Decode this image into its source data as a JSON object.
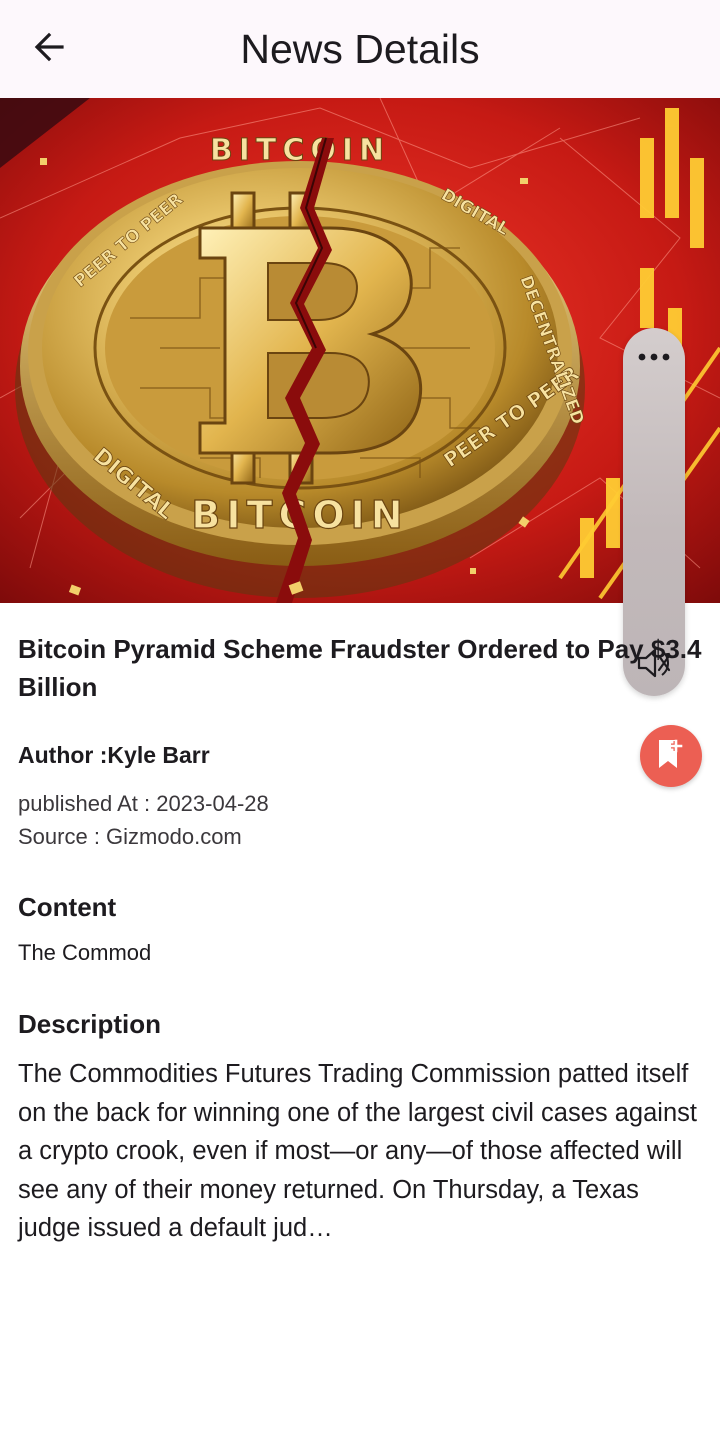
{
  "appbar": {
    "title": "News Details",
    "back_icon": "arrow-left-icon"
  },
  "hero": {
    "image": "bitcoin-coin-cracked-photo",
    "coin_top_text": "BITCOIN",
    "coin_bottom_text": "BITCOIN",
    "coin_ring_left": "DIGITAL",
    "coin_ring_right": "PEER TO PEER",
    "coin_ring_upper_right": "DECENTRALIZED",
    "coin_ring_upper": "DIGITAL",
    "coin_ring_upper_left": "PEER TO PEER"
  },
  "floating_panel": {
    "more_icon": "more-horizontal-icon",
    "mute_icon": "volume-mute-icon"
  },
  "bookmark": {
    "icon": "bookmark-add-icon",
    "color": "#ec5f53"
  },
  "article": {
    "title": "Bitcoin Pyramid Scheme Fraudster Ordered to Pay $3.4 Billion",
    "author": "Author :Kyle Barr",
    "published": "published At : 2023-04-28",
    "source": "Source : Gizmodo.com",
    "content_heading": "Content",
    "content": "The Commod",
    "description_heading": "Description",
    "description": "The Commodities Futures Trading Commission patted itself on the back for winning one of the largest civil cases against a crypto crook, even if most—or any—of those affected will see any of their money returned. On Thursday, a Texas judge issued a default jud…"
  }
}
